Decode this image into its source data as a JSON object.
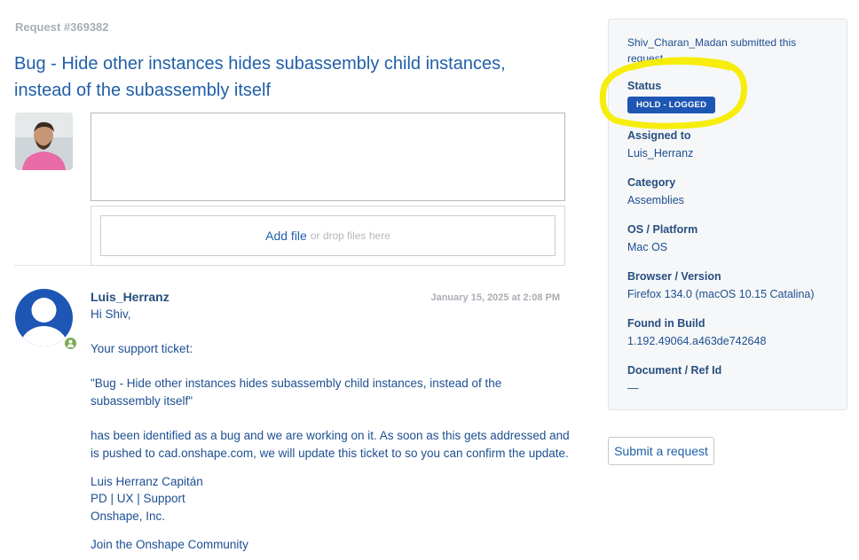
{
  "request": {
    "id_label": "Request #369382",
    "title": "Bug - Hide other instances hides subassembly child instances, instead of the subassembly itself"
  },
  "composer": {
    "comment_value": "",
    "add_file": "Add file",
    "drop_hint": "or drop files here"
  },
  "comment": {
    "author": "Luis_Herranz",
    "timestamp": "January 15, 2025 at 2:08 PM",
    "greeting": "Hi Shiv,",
    "intro": "Your support ticket:",
    "quote": "\"Bug - Hide other instances hides subassembly child instances, instead of the subassembly itself\"",
    "message": "has been identified as a bug and we are working on it. As soon as this gets addressed and is pushed to cad.onshape.com, we will update this ticket to so you can confirm the update.",
    "sig_name": "Luis Herranz Capitán",
    "sig_role": "PD | UX | Support",
    "sig_company": "Onshape, Inc.",
    "community_link": "Join the Onshape Community"
  },
  "sidebar": {
    "submitter": "Shiv_Charan_Madan submitted this request",
    "status_label": "Status",
    "status_value": "HOLD - LOGGED",
    "assigned_label": "Assigned to",
    "assigned_value": "Luis_Herranz",
    "category_label": "Category",
    "category_value": "Assemblies",
    "os_label": "OS / Platform",
    "os_value": "Mac OS",
    "browser_label": "Browser / Version",
    "browser_value": "Firefox 134.0 (macOS 10.15 Catalina)",
    "build_label": "Found in Build",
    "build_value": "1.192.49064.a463de742648",
    "docref_label": "Document / Ref Id",
    "docref_value": "—"
  },
  "actions": {
    "submit_request": "Submit a request"
  },
  "colors": {
    "status_badge": "#1e56b3",
    "highlight_marker": "#f5ec00",
    "agent_badge": "#7bab54",
    "link": "#1f5fa8"
  },
  "icons": {
    "user_avatar": "user-photo-icon",
    "agent_avatar": "default-avatar-icon",
    "agent_badge": "agent-person-icon"
  }
}
